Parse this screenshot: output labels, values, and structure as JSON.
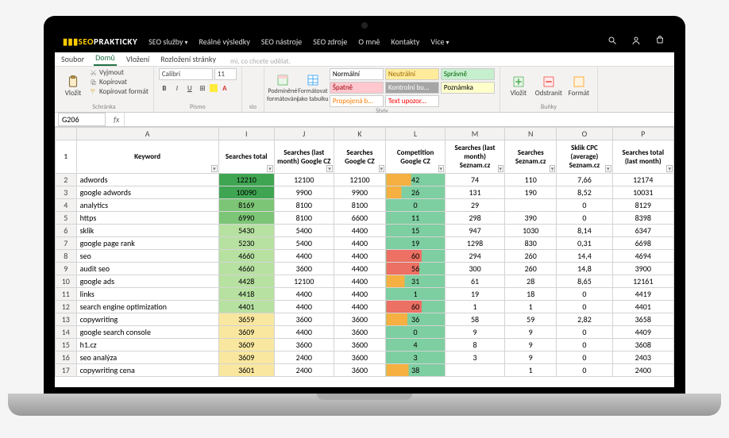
{
  "site_nav": {
    "logo_bars": "▮▮▮",
    "logo_seo": "SEO",
    "logo_rest": "PRAKTICKY",
    "items": [
      {
        "label": "SEO služby",
        "dropdown": true
      },
      {
        "label": "Reálné výsledky",
        "dropdown": false
      },
      {
        "label": "SEO nástroje",
        "dropdown": false
      },
      {
        "label": "SEO zdroje",
        "dropdown": false
      },
      {
        "label": "O mně",
        "dropdown": false
      },
      {
        "label": "Kontakty",
        "dropdown": false
      },
      {
        "label": "Více",
        "dropdown": true
      }
    ]
  },
  "excel_tabs": {
    "tabs": [
      "Soubor",
      "Domů",
      "Vložení",
      "Rozložení stránky"
    ],
    "active_index": 1,
    "hint": "mi, co chcete udělat."
  },
  "ribbon": {
    "clipboard": {
      "paste": "Vložit",
      "cut": "Vyjmout",
      "copy": "Kopírovat",
      "format_painter": "Kopírovat formát",
      "group": "Schránka"
    },
    "font": {
      "name": "Calibri",
      "size": "11",
      "group": "Písmo"
    },
    "align_group": "slo",
    "cond_format": "Podmíněné formátování",
    "as_table": "Formátovat jako tabulku",
    "styles": {
      "chips": [
        {
          "label": "Normální",
          "bg": "#ffffff",
          "fg": "#000"
        },
        {
          "label": "Neutrální",
          "bg": "#ffeb9c",
          "fg": "#9c6500"
        },
        {
          "label": "Správně",
          "bg": "#c6efce",
          "fg": "#006100"
        },
        {
          "label": "Špatně",
          "bg": "#ffc7ce",
          "fg": "#9c0006"
        },
        {
          "label": "Kontrolní bu...",
          "bg": "#a5a5a5",
          "fg": "#fff"
        },
        {
          "label": "Poznámka",
          "bg": "#ffffcc",
          "fg": "#000"
        },
        {
          "label": "Propojená b...",
          "bg": "#fff",
          "fg": "#fa7d00"
        },
        {
          "label": "Text upozor...",
          "bg": "#fff",
          "fg": "#ff0000"
        }
      ],
      "group": "Styly"
    },
    "cells": {
      "insert": "Vložit",
      "delete": "Odstranit",
      "format": "Formát",
      "group": "Buňky"
    }
  },
  "name_box": "G206",
  "chart_data": {
    "type": "table",
    "col_letters": [
      "A",
      "I",
      "J",
      "K",
      "L",
      "M",
      "N",
      "O",
      "P"
    ],
    "headers": [
      "Keyword",
      "Searches total",
      "Searches (last month) Google CZ",
      "Searches Google CZ",
      "Competition Google CZ",
      "Searches (last month) Seznam.cz",
      "Searches Seznam.cz",
      "Sklik CPC (average) Seznam.cz",
      "Searches total (last month)"
    ],
    "rows": [
      {
        "n": 2,
        "kw": "adwords",
        "tot": 12210,
        "lmg": 12100,
        "sg": 12100,
        "comp": 42,
        "lms": 74,
        "ss": 110,
        "cpc": "7,66",
        "tlm": 12174
      },
      {
        "n": 3,
        "kw": "google adwords",
        "tot": 10090,
        "lmg": 9900,
        "sg": 9900,
        "comp": 26,
        "lms": 131,
        "ss": 190,
        "cpc": "8,52",
        "tlm": 10031
      },
      {
        "n": 4,
        "kw": "analytics",
        "tot": 8169,
        "lmg": 8100,
        "sg": 8100,
        "comp": 0,
        "lms": 29,
        "ss": "",
        "cpc": "0",
        "tlm": 8129
      },
      {
        "n": 5,
        "kw": "https",
        "tot": 6990,
        "lmg": 8100,
        "sg": 6600,
        "comp": 11,
        "lms": 298,
        "ss": 390,
        "cpc": "0",
        "tlm": 8398
      },
      {
        "n": 6,
        "kw": "sklik",
        "tot": 5430,
        "lmg": 5400,
        "sg": 4400,
        "comp": 15,
        "lms": 947,
        "ss": 1030,
        "cpc": "8,14",
        "tlm": 6347
      },
      {
        "n": 7,
        "kw": "google page rank",
        "tot": 5230,
        "lmg": 5400,
        "sg": 4400,
        "comp": 19,
        "lms": 1298,
        "ss": 830,
        "cpc": "0,31",
        "tlm": 6698
      },
      {
        "n": 8,
        "kw": "seo",
        "tot": 4660,
        "lmg": 4400,
        "sg": 4400,
        "comp": 60,
        "lms": 294,
        "ss": 260,
        "cpc": "14,4",
        "tlm": 4694
      },
      {
        "n": 9,
        "kw": "audit seo",
        "tot": 4660,
        "lmg": 3600,
        "sg": 4400,
        "comp": 56,
        "lms": 300,
        "ss": 260,
        "cpc": "14,8",
        "tlm": 3900
      },
      {
        "n": 10,
        "kw": "google ads",
        "tot": 4428,
        "lmg": 12100,
        "sg": 4400,
        "comp": 31,
        "lms": 61,
        "ss": 28,
        "cpc": "8,65",
        "tlm": 12161
      },
      {
        "n": 11,
        "kw": "links",
        "tot": 4418,
        "lmg": 4400,
        "sg": 4400,
        "comp": 1,
        "lms": 19,
        "ss": 18,
        "cpc": "0",
        "tlm": 4419
      },
      {
        "n": 12,
        "kw": "search engine optimization",
        "tot": 4401,
        "lmg": 4400,
        "sg": 4400,
        "comp": 60,
        "lms": 1,
        "ss": 1,
        "cpc": "0",
        "tlm": 4401
      },
      {
        "n": 13,
        "kw": "copywriting",
        "tot": 3659,
        "lmg": 3600,
        "sg": 3600,
        "comp": 36,
        "lms": 58,
        "ss": 59,
        "cpc": "2,82",
        "tlm": 3658
      },
      {
        "n": 14,
        "kw": "google search console",
        "tot": 3609,
        "lmg": 4400,
        "sg": 3600,
        "comp": 0,
        "lms": 9,
        "ss": 9,
        "cpc": "0",
        "tlm": 4409
      },
      {
        "n": 15,
        "kw": "h1.cz",
        "tot": 3609,
        "lmg": 3600,
        "sg": 3600,
        "comp": 4,
        "lms": 8,
        "ss": 9,
        "cpc": "0",
        "tlm": 3608
      },
      {
        "n": 16,
        "kw": "seo analýza",
        "tot": 3609,
        "lmg": 2400,
        "sg": 3600,
        "comp": 3,
        "lms": 3,
        "ss": 9,
        "cpc": "0",
        "tlm": 2403
      },
      {
        "n": 17,
        "kw": "copywriting cena",
        "tot": 3601,
        "lmg": 2400,
        "sg": 3600,
        "comp": 38,
        "lms": "",
        "ss": 1,
        "cpc": "0",
        "tlm": 2400
      }
    ]
  }
}
